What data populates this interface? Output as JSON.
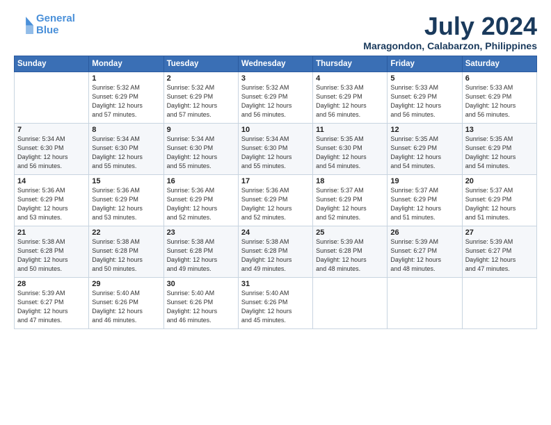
{
  "header": {
    "logo_line1": "General",
    "logo_line2": "Blue",
    "title": "July 2024",
    "subtitle": "Maragondon, Calabarzon, Philippines"
  },
  "days_of_week": [
    "Sunday",
    "Monday",
    "Tuesday",
    "Wednesday",
    "Thursday",
    "Friday",
    "Saturday"
  ],
  "weeks": [
    [
      {
        "num": "",
        "text": ""
      },
      {
        "num": "1",
        "text": "Sunrise: 5:32 AM\nSunset: 6:29 PM\nDaylight: 12 hours\nand 57 minutes."
      },
      {
        "num": "2",
        "text": "Sunrise: 5:32 AM\nSunset: 6:29 PM\nDaylight: 12 hours\nand 57 minutes."
      },
      {
        "num": "3",
        "text": "Sunrise: 5:32 AM\nSunset: 6:29 PM\nDaylight: 12 hours\nand 56 minutes."
      },
      {
        "num": "4",
        "text": "Sunrise: 5:33 AM\nSunset: 6:29 PM\nDaylight: 12 hours\nand 56 minutes."
      },
      {
        "num": "5",
        "text": "Sunrise: 5:33 AM\nSunset: 6:29 PM\nDaylight: 12 hours\nand 56 minutes."
      },
      {
        "num": "6",
        "text": "Sunrise: 5:33 AM\nSunset: 6:29 PM\nDaylight: 12 hours\nand 56 minutes."
      }
    ],
    [
      {
        "num": "7",
        "text": "Sunrise: 5:34 AM\nSunset: 6:30 PM\nDaylight: 12 hours\nand 56 minutes."
      },
      {
        "num": "8",
        "text": "Sunrise: 5:34 AM\nSunset: 6:30 PM\nDaylight: 12 hours\nand 55 minutes."
      },
      {
        "num": "9",
        "text": "Sunrise: 5:34 AM\nSunset: 6:30 PM\nDaylight: 12 hours\nand 55 minutes."
      },
      {
        "num": "10",
        "text": "Sunrise: 5:34 AM\nSunset: 6:30 PM\nDaylight: 12 hours\nand 55 minutes."
      },
      {
        "num": "11",
        "text": "Sunrise: 5:35 AM\nSunset: 6:30 PM\nDaylight: 12 hours\nand 54 minutes."
      },
      {
        "num": "12",
        "text": "Sunrise: 5:35 AM\nSunset: 6:29 PM\nDaylight: 12 hours\nand 54 minutes."
      },
      {
        "num": "13",
        "text": "Sunrise: 5:35 AM\nSunset: 6:29 PM\nDaylight: 12 hours\nand 54 minutes."
      }
    ],
    [
      {
        "num": "14",
        "text": "Sunrise: 5:36 AM\nSunset: 6:29 PM\nDaylight: 12 hours\nand 53 minutes."
      },
      {
        "num": "15",
        "text": "Sunrise: 5:36 AM\nSunset: 6:29 PM\nDaylight: 12 hours\nand 53 minutes."
      },
      {
        "num": "16",
        "text": "Sunrise: 5:36 AM\nSunset: 6:29 PM\nDaylight: 12 hours\nand 52 minutes."
      },
      {
        "num": "17",
        "text": "Sunrise: 5:36 AM\nSunset: 6:29 PM\nDaylight: 12 hours\nand 52 minutes."
      },
      {
        "num": "18",
        "text": "Sunrise: 5:37 AM\nSunset: 6:29 PM\nDaylight: 12 hours\nand 52 minutes."
      },
      {
        "num": "19",
        "text": "Sunrise: 5:37 AM\nSunset: 6:29 PM\nDaylight: 12 hours\nand 51 minutes."
      },
      {
        "num": "20",
        "text": "Sunrise: 5:37 AM\nSunset: 6:29 PM\nDaylight: 12 hours\nand 51 minutes."
      }
    ],
    [
      {
        "num": "21",
        "text": "Sunrise: 5:38 AM\nSunset: 6:28 PM\nDaylight: 12 hours\nand 50 minutes."
      },
      {
        "num": "22",
        "text": "Sunrise: 5:38 AM\nSunset: 6:28 PM\nDaylight: 12 hours\nand 50 minutes."
      },
      {
        "num": "23",
        "text": "Sunrise: 5:38 AM\nSunset: 6:28 PM\nDaylight: 12 hours\nand 49 minutes."
      },
      {
        "num": "24",
        "text": "Sunrise: 5:38 AM\nSunset: 6:28 PM\nDaylight: 12 hours\nand 49 minutes."
      },
      {
        "num": "25",
        "text": "Sunrise: 5:39 AM\nSunset: 6:28 PM\nDaylight: 12 hours\nand 48 minutes."
      },
      {
        "num": "26",
        "text": "Sunrise: 5:39 AM\nSunset: 6:27 PM\nDaylight: 12 hours\nand 48 minutes."
      },
      {
        "num": "27",
        "text": "Sunrise: 5:39 AM\nSunset: 6:27 PM\nDaylight: 12 hours\nand 47 minutes."
      }
    ],
    [
      {
        "num": "28",
        "text": "Sunrise: 5:39 AM\nSunset: 6:27 PM\nDaylight: 12 hours\nand 47 minutes."
      },
      {
        "num": "29",
        "text": "Sunrise: 5:40 AM\nSunset: 6:26 PM\nDaylight: 12 hours\nand 46 minutes."
      },
      {
        "num": "30",
        "text": "Sunrise: 5:40 AM\nSunset: 6:26 PM\nDaylight: 12 hours\nand 46 minutes."
      },
      {
        "num": "31",
        "text": "Sunrise: 5:40 AM\nSunset: 6:26 PM\nDaylight: 12 hours\nand 45 minutes."
      },
      {
        "num": "",
        "text": ""
      },
      {
        "num": "",
        "text": ""
      },
      {
        "num": "",
        "text": ""
      }
    ]
  ]
}
